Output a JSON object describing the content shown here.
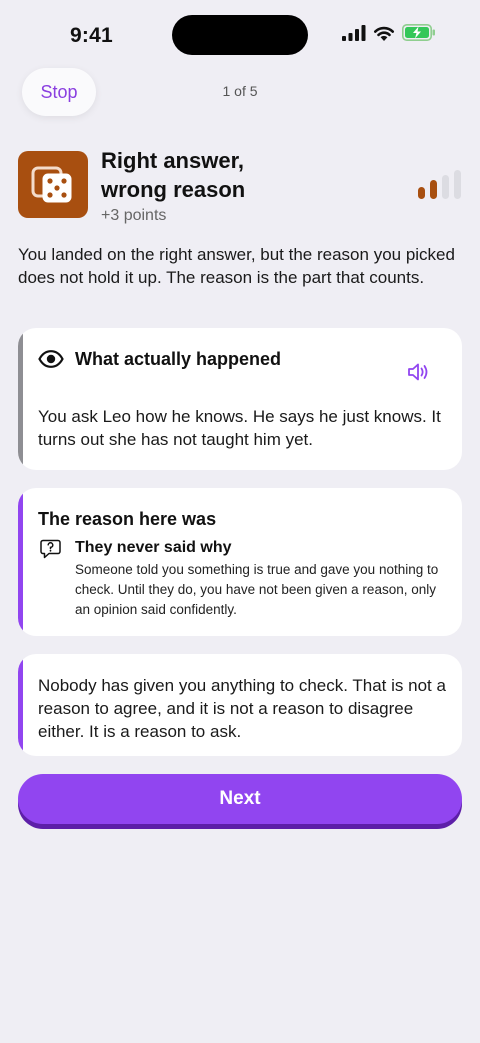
{
  "status_bar": {
    "time": "9:41"
  },
  "header": {
    "stop_label": "Stop",
    "progress": "1 of 5"
  },
  "result": {
    "title": "Right answer, wrong reason",
    "points": "+3 points",
    "icon": "dice-icon",
    "icon_color": "#a84f10",
    "level_filled": 2,
    "level_total": 4
  },
  "intro": "You landed on the right answer, but the reason you picked does not hold it up. The reason is the part that counts.",
  "what_happened": {
    "title": "What actually happened",
    "body": "You ask Leo how he knows. He says he just knows. It turns out she has not taught him yet.",
    "accent": "#8e8e93"
  },
  "reason": {
    "title": "The reason here was",
    "subtitle": "They never said why",
    "body": "Someone told you something is true and gave you nothing to check. Until they do, you have not been given a reason, only an opinion said confidently.",
    "accent": "#9145f0"
  },
  "advice": {
    "body": "Nobody has given you anything to check. That is not a reason to agree, and it is not a reason to disagree either. It is a reason to ask.",
    "accent": "#9145f0"
  },
  "next_label": "Next",
  "colors": {
    "accent": "#9145f0",
    "background": "#efeef4"
  }
}
